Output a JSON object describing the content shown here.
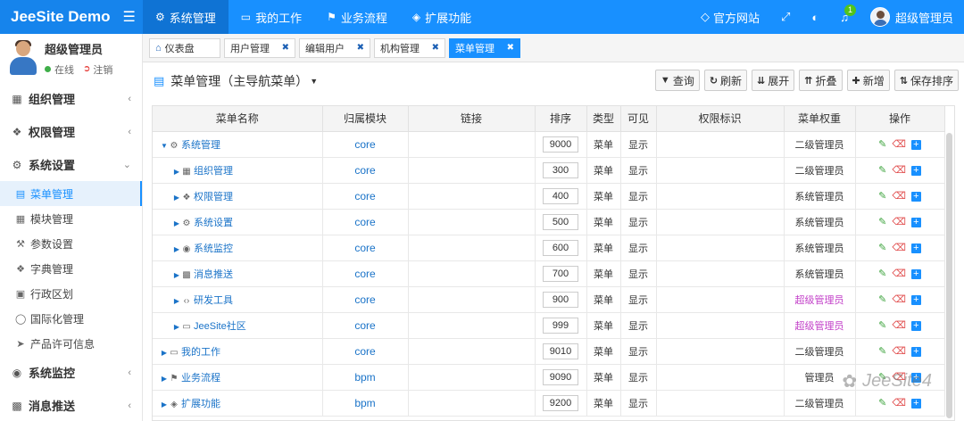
{
  "header": {
    "brand": "JeeSite Demo",
    "nav": [
      {
        "label": "系统管理",
        "icon": "gear-icon",
        "active": true
      },
      {
        "label": "我的工作",
        "icon": "monitor-icon",
        "active": false
      },
      {
        "label": "业务流程",
        "icon": "flag-icon",
        "active": false
      },
      {
        "label": "扩展功能",
        "icon": "layers-icon",
        "active": false
      }
    ],
    "right": {
      "website": "官方网站",
      "notify_count": "1",
      "username": "超级管理员"
    }
  },
  "sidebar": {
    "user": {
      "name": "超级管理员",
      "status": "在线",
      "logout": "注销"
    },
    "groups": [
      {
        "label": "组织管理"
      },
      {
        "label": "权限管理"
      },
      {
        "label": "系统设置"
      }
    ],
    "sub_items": [
      {
        "label": "菜单管理"
      },
      {
        "label": "模块管理"
      },
      {
        "label": "参数设置"
      },
      {
        "label": "字典管理"
      },
      {
        "label": "行政区划"
      },
      {
        "label": "国际化管理"
      },
      {
        "label": "产品许可信息"
      }
    ],
    "groups_bottom": [
      {
        "label": "系统监控"
      },
      {
        "label": "消息推送"
      }
    ]
  },
  "tabs": [
    {
      "label": "仪表盘",
      "closable": false
    },
    {
      "label": "用户管理",
      "closable": true
    },
    {
      "label": "编辑用户",
      "closable": true
    },
    {
      "label": "机构管理",
      "closable": true
    },
    {
      "label": "菜单管理",
      "closable": true,
      "active": true
    }
  ],
  "page": {
    "title": "菜单管理（主导航菜单",
    "toolbar": {
      "query": "查询",
      "refresh": "刷新",
      "expand": "展开",
      "collapse": "折叠",
      "add": "新增",
      "save_sort": "保存排序"
    }
  },
  "table": {
    "columns": [
      "菜单名称",
      "归属模块",
      "链接",
      "排序",
      "类型",
      "可见",
      "权限标识",
      "菜单权重",
      "操作"
    ],
    "rows": [
      {
        "name": "系统管理",
        "module": "core",
        "sort": "9000",
        "type": "菜单",
        "visible": "显示",
        "weight": "二级管理员",
        "level": 0,
        "expanded": true
      },
      {
        "name": "组织管理",
        "module": "core",
        "sort": "300",
        "type": "菜单",
        "visible": "显示",
        "weight": "二级管理员",
        "level": 1
      },
      {
        "name": "权限管理",
        "module": "core",
        "sort": "400",
        "type": "菜单",
        "visible": "显示",
        "weight": "系统管理员",
        "level": 1
      },
      {
        "name": "系统设置",
        "module": "core",
        "sort": "500",
        "type": "菜单",
        "visible": "显示",
        "weight": "系统管理员",
        "level": 1
      },
      {
        "name": "系统监控",
        "module": "core",
        "sort": "600",
        "type": "菜单",
        "visible": "显示",
        "weight": "系统管理员",
        "level": 1
      },
      {
        "name": "消息推送",
        "module": "core",
        "sort": "700",
        "type": "菜单",
        "visible": "显示",
        "weight": "系统管理员",
        "level": 1
      },
      {
        "name": "研发工具",
        "module": "core",
        "sort": "900",
        "type": "菜单",
        "visible": "显示",
        "weight": "超级管理员",
        "level": 1
      },
      {
        "name": "JeeSite社区",
        "module": "core",
        "sort": "999",
        "type": "菜单",
        "visible": "显示",
        "weight": "超级管理员",
        "level": 1
      },
      {
        "name": "我的工作",
        "module": "core",
        "sort": "9010",
        "type": "菜单",
        "visible": "显示",
        "weight": "二级管理员",
        "level": 0
      },
      {
        "name": "业务流程",
        "module": "bpm",
        "sort": "9090",
        "type": "菜单",
        "visible": "显示",
        "weight": "管理员",
        "level": 0
      },
      {
        "name": "扩展功能",
        "module": "bpm",
        "sort": "9200",
        "type": "菜单",
        "visible": "显示",
        "weight": "二级管理员",
        "level": 0
      }
    ]
  },
  "watermark": "JeeSite4",
  "colors": {
    "primary": "#1890ff",
    "super_admin": "#c23fc8"
  }
}
